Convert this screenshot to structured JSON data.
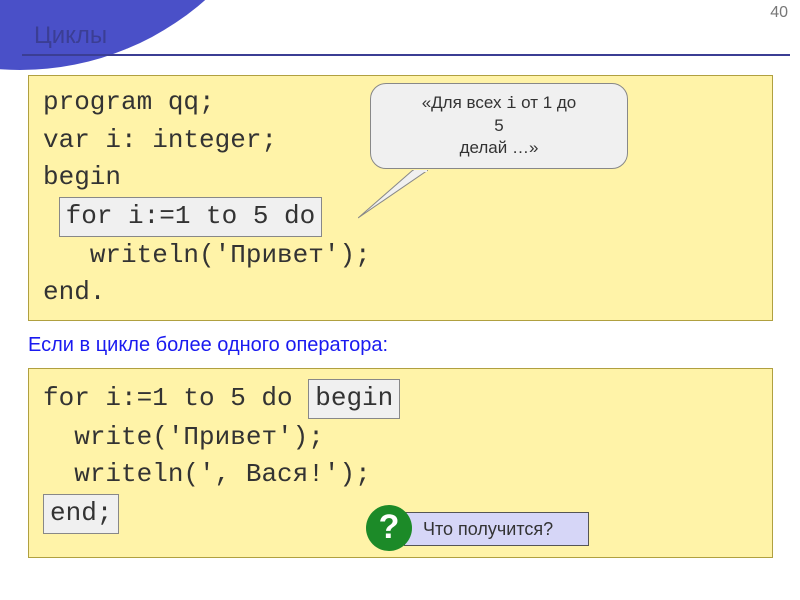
{
  "page_number": "40",
  "title": "Циклы",
  "code1": {
    "line1": "program qq;",
    "line2": "var i: integer;",
    "line3": "begin",
    "for_highlight": "for i:=1 to 5 do",
    "line5": "writeln('Привет');",
    "line6": "end."
  },
  "bubble": {
    "line1_pre": "«Для всех ",
    "line1_i": "i",
    "line1_post": " от 1 до",
    "line2": "5",
    "line3": "делай …»"
  },
  "midtext": "Если в цикле более одного оператора:",
  "code2": {
    "line1_pre": "for i:=1 to 5 do ",
    "begin_hl": "begin",
    "line2": "write('Привет');",
    "line3": "writeln(', Вася!');",
    "end_hl": "end;"
  },
  "question": {
    "mark": "?",
    "text": "Что получится?"
  }
}
